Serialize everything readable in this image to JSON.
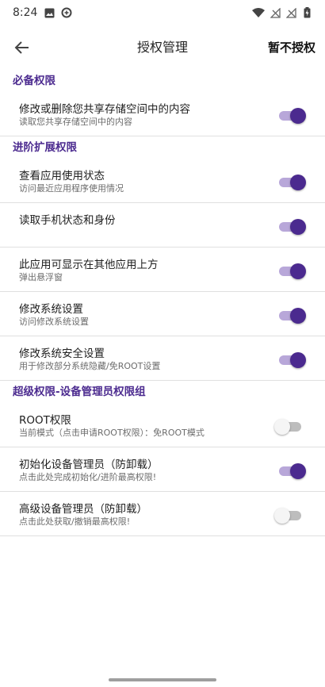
{
  "status_bar": {
    "time": "8:24",
    "icons": [
      "image-icon",
      "data-saver-icon",
      "wifi-icon",
      "signal-off-icon",
      "signal-off-icon",
      "battery-charging-icon"
    ]
  },
  "toolbar": {
    "title": "授权管理",
    "skip_label": "暂不授权",
    "back_icon": "arrow-back-icon"
  },
  "colors": {
    "accent": "#4b2a8f",
    "switch_track_on": "#b8a7d9",
    "switch_off": "#bdbdbd"
  },
  "sections": [
    {
      "header": "必备权限",
      "items": [
        {
          "title": "修改或删除您共享存储空间中的内容",
          "subtitle": "读取您共享存储空间中的内容",
          "enabled": true
        }
      ]
    },
    {
      "header": "进阶扩展权限",
      "items": [
        {
          "title": "查看应用使用状态",
          "subtitle": "访问最近应用程序使用情况",
          "enabled": true
        },
        {
          "title": "读取手机状态和身份",
          "subtitle": "",
          "enabled": true
        },
        {
          "title": "此应用可显示在其他应用上方",
          "subtitle": "弹出悬浮窗",
          "enabled": true
        },
        {
          "title": "修改系统设置",
          "subtitle": "访问修改系统设置",
          "enabled": true
        },
        {
          "title": "修改系统安全设置",
          "subtitle": "用于修改部分系统隐藏/免ROOT设置",
          "enabled": true
        }
      ]
    },
    {
      "header": "超级权限-设备管理员权限组",
      "items": [
        {
          "title": "ROOT权限",
          "subtitle": "当前模式（点击申请ROOT权限）：免ROOT模式",
          "enabled": false
        },
        {
          "title": "初始化设备管理员（防卸载）",
          "subtitle": "点击此处完成初始化/进阶最高权限!",
          "enabled": true
        },
        {
          "title": "高级设备管理员（防卸载）",
          "subtitle": "点击此处获取/撤销最高权限!",
          "enabled": false
        }
      ]
    }
  ]
}
